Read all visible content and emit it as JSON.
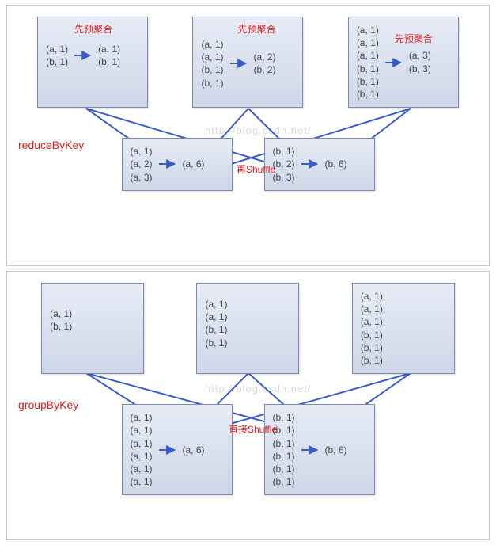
{
  "watermark": "http://blog.csdn.net/",
  "reduceByKey": {
    "title": "reduceByKey",
    "pre_label": "先预聚合",
    "shuffle_label": "再Shuffle",
    "top": [
      {
        "in": [
          "(a, 1)",
          "(b, 1)"
        ],
        "out": [
          "(a, 1)",
          "(b, 1)"
        ]
      },
      {
        "in": [
          "(a, 1)",
          "(a, 1)",
          "(b, 1)",
          "(b, 1)"
        ],
        "out": [
          "(a, 2)",
          "(b, 2)"
        ]
      },
      {
        "in": [
          "(a, 1)",
          "(a, 1)",
          "(a, 1)",
          "(b, 1)",
          "(b, 1)",
          "(b, 1)"
        ],
        "out": [
          "(a, 3)",
          "(b, 3)"
        ]
      }
    ],
    "bottom": [
      {
        "in": [
          "(a, 1)",
          "(a, 2)",
          "(a, 3)"
        ],
        "out": "(a, 6)"
      },
      {
        "in": [
          "(b, 1)",
          "(b, 2)",
          "(b, 3)"
        ],
        "out": "(b, 6)"
      }
    ]
  },
  "groupByKey": {
    "title": "groupByKey",
    "shuffle_label": "直接Shuffle",
    "top": [
      [
        "(a, 1)",
        "(b, 1)"
      ],
      [
        "(a, 1)",
        "(a, 1)",
        "(b, 1)",
        "(b, 1)"
      ],
      [
        "(a, 1)",
        "(a, 1)",
        "(a, 1)",
        "(b, 1)",
        "(b, 1)",
        "(b, 1)"
      ]
    ],
    "bottom": [
      {
        "in": [
          "(a, 1)",
          "(a, 1)",
          "(a, 1)",
          "(a, 1)",
          "(a, 1)",
          "(a, 1)"
        ],
        "out": "(a, 6)"
      },
      {
        "in": [
          "(b, 1)",
          "(b, 1)",
          "(b, 1)",
          "(b, 1)",
          "(b, 1)",
          "(b, 1)"
        ],
        "out": "(b, 6)"
      }
    ]
  },
  "chart_data": [
    {
      "type": "diagram",
      "title": "reduceByKey",
      "annotations": [
        "先预聚合",
        "再Shuffle"
      ],
      "mappers": [
        {
          "input": [
            [
              "a",
              1
            ],
            [
              "b",
              1
            ]
          ],
          "combined": [
            [
              "a",
              1
            ],
            [
              "b",
              1
            ]
          ]
        },
        {
          "input": [
            [
              "a",
              1
            ],
            [
              "a",
              1
            ],
            [
              "b",
              1
            ],
            [
              "b",
              1
            ]
          ],
          "combined": [
            [
              "a",
              2
            ],
            [
              "b",
              2
            ]
          ]
        },
        {
          "input": [
            [
              "a",
              1
            ],
            [
              "a",
              1
            ],
            [
              "a",
              1
            ],
            [
              "b",
              1
            ],
            [
              "b",
              1
            ],
            [
              "b",
              1
            ]
          ],
          "combined": [
            [
              "a",
              3
            ],
            [
              "b",
              3
            ]
          ]
        }
      ],
      "reducers": [
        {
          "inputs": [
            [
              "a",
              1
            ],
            [
              "a",
              2
            ],
            [
              "a",
              3
            ]
          ],
          "output": [
            "a",
            6
          ]
        },
        {
          "inputs": [
            [
              "b",
              1
            ],
            [
              "b",
              2
            ],
            [
              "b",
              3
            ]
          ],
          "output": [
            "b",
            6
          ]
        }
      ]
    },
    {
      "type": "diagram",
      "title": "groupByKey",
      "annotations": [
        "直接Shuffle"
      ],
      "mappers": [
        {
          "input": [
            [
              "a",
              1
            ],
            [
              "b",
              1
            ]
          ]
        },
        {
          "input": [
            [
              "a",
              1
            ],
            [
              "a",
              1
            ],
            [
              "b",
              1
            ],
            [
              "b",
              1
            ]
          ]
        },
        {
          "input": [
            [
              "a",
              1
            ],
            [
              "a",
              1
            ],
            [
              "a",
              1
            ],
            [
              "b",
              1
            ],
            [
              "b",
              1
            ],
            [
              "b",
              1
            ]
          ]
        }
      ],
      "reducers": [
        {
          "inputs": [
            [
              "a",
              1
            ],
            [
              "a",
              1
            ],
            [
              "a",
              1
            ],
            [
              "a",
              1
            ],
            [
              "a",
              1
            ],
            [
              "a",
              1
            ]
          ],
          "output": [
            "a",
            6
          ]
        },
        {
          "inputs": [
            [
              "b",
              1
            ],
            [
              "b",
              1
            ],
            [
              "b",
              1
            ],
            [
              "b",
              1
            ],
            [
              "b",
              1
            ],
            [
              "b",
              1
            ]
          ],
          "output": [
            "b",
            6
          ]
        }
      ]
    }
  ]
}
